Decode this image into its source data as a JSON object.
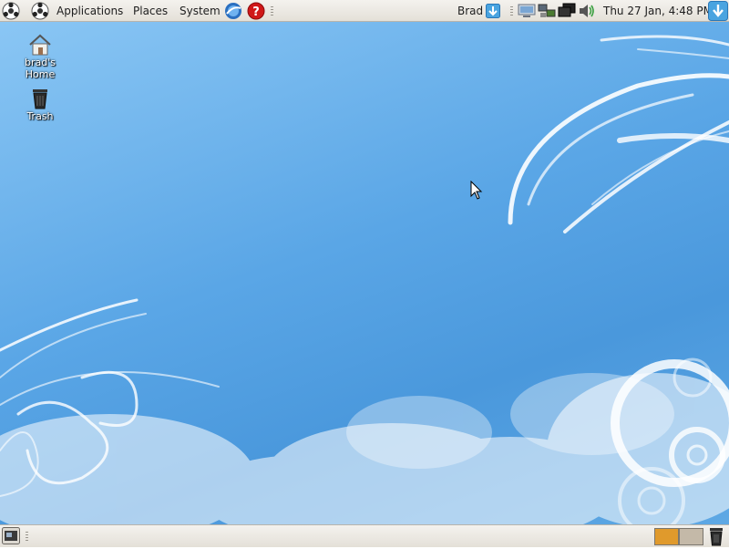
{
  "top_panel": {
    "menus": {
      "applications": "Applications",
      "places": "Places",
      "system": "System"
    },
    "user_name": "Brad",
    "clock": "Thu 27 Jan,  4:48 PM",
    "icons": [
      "main-menu-logo",
      "help-icon",
      "web-browser-icon",
      "network-icon",
      "volume-icon",
      "update-icon"
    ]
  },
  "desktop": {
    "home_icon_label": "brad's\nHome",
    "trash_icon_label": "Trash"
  },
  "bottom_panel": {
    "workspaces": 2,
    "active_workspace": 1
  },
  "colors": {
    "panel": "#ece9e3",
    "desktop_blue": "#5aa6e6",
    "workspace_active": "#e09a2c",
    "workspace_inactive": "#c4b9a8"
  }
}
